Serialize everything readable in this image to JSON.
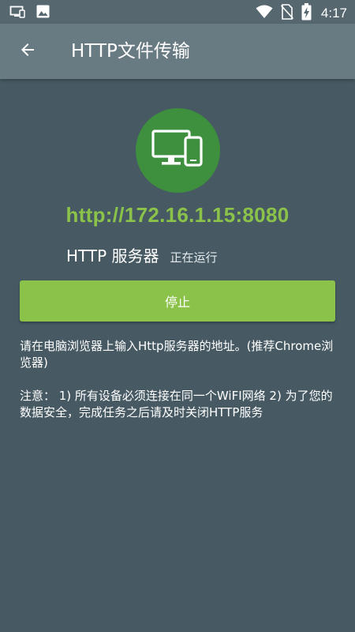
{
  "status_bar": {
    "time": "4:17",
    "icons": [
      "monitor-icon",
      "image-icon",
      "wifi-icon",
      "no-sim-icon",
      "battery-charging-icon"
    ]
  },
  "app_bar": {
    "title": "HTTP文件传输",
    "back_icon": "arrow-back-icon"
  },
  "server": {
    "icon": "monitor-phone-icon",
    "url": "http://172.16.1.15:8080",
    "name": "HTTP 服务器",
    "state": "正在运行"
  },
  "actions": {
    "stop_label": "停止"
  },
  "instructions": {
    "info": "请在电脑浏览器上输入Http服务器的地址。(推荐Chrome浏览器)",
    "note": "注意： 1) 所有设备必须连接在同一个WiFI网络 2) 为了您的数据安全，完成任务之后请及时关闭HTTP服务"
  },
  "colors": {
    "background": "#475a63",
    "app_bar": "#687a82",
    "status_bar": "#56676f",
    "accent_green": "#8bc34a",
    "icon_circle": "#3e8f3e"
  }
}
